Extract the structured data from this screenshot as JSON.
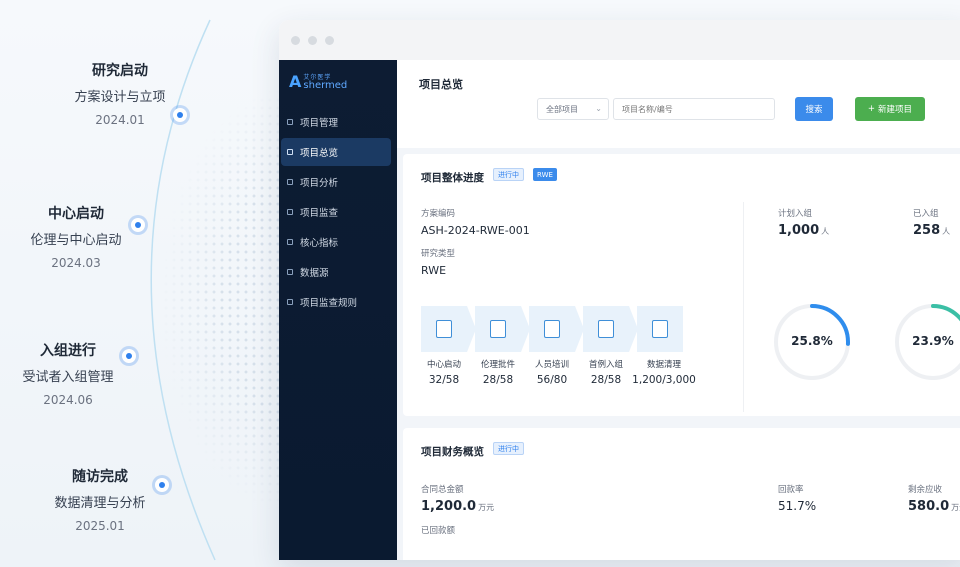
{
  "timeline": [
    {
      "title": "研究启动",
      "sub": "方案设计与立项",
      "date": "2024.01"
    },
    {
      "title": "中心启动",
      "sub": "伦理与中心启动",
      "date": "2024.03"
    },
    {
      "title": "入组进行",
      "sub": "受试者入组管理",
      "date": "2024.06"
    },
    {
      "title": "随访完成",
      "sub": "数据清理与分析",
      "date": "2025.01"
    }
  ],
  "logo": {
    "mark": "A",
    "cn": "艾尔医学",
    "en": "shermed"
  },
  "sidebar": {
    "items": [
      {
        "label": "项目管理"
      },
      {
        "label": "项目总览"
      },
      {
        "label": "项目分析"
      },
      {
        "label": "项目监查"
      },
      {
        "label": "核心指标"
      },
      {
        "label": "数据源"
      },
      {
        "label": "项目监查规则"
      }
    ]
  },
  "header": {
    "title": "项目总览",
    "select_value": "全部项目",
    "search_placeholder": "项目名称/编号",
    "search_button": "搜索",
    "new_button": "新建项目",
    "new_icon": "+"
  },
  "progress": {
    "title": "项目整体进度",
    "status_tag": "进行中",
    "type_tag": "RWE",
    "scheme_code_label": "方案编码",
    "scheme_code": "ASH-2024-RWE-001",
    "study_type_label": "研究类型",
    "study_type": "RWE",
    "planned_label": "计划入组",
    "planned_value": "1,000",
    "planned_unit": "人",
    "enrolled_label": "已入组",
    "enrolled_value": "258",
    "enrolled_unit": "人",
    "ring1": {
      "value": "25.8%",
      "fraction": 0.258,
      "color": "#2f8ded"
    },
    "ring2": {
      "value": "23.9%",
      "fraction": 0.239,
      "color": "#3bbfa5"
    },
    "steps": [
      {
        "name": "中心启动",
        "value": "32/58"
      },
      {
        "name": "伦理批件",
        "value": "28/58"
      },
      {
        "name": "人员培训",
        "value": "56/80"
      },
      {
        "name": "首例入组",
        "value": "28/58"
      },
      {
        "name": "数据清理",
        "value": "1,200/3,000"
      }
    ]
  },
  "finance": {
    "title": "项目财务概览",
    "status_tag": "进行中",
    "contract_label": "合同总金额",
    "contract_value": "1,200.0",
    "contract_unit": "万元",
    "received_label": "已回款额",
    "rate_label": "回款率",
    "rate_value": "51.7%",
    "remaining_label": "剩余应收",
    "remaining_value": "580.0",
    "remaining_unit": "万元"
  }
}
